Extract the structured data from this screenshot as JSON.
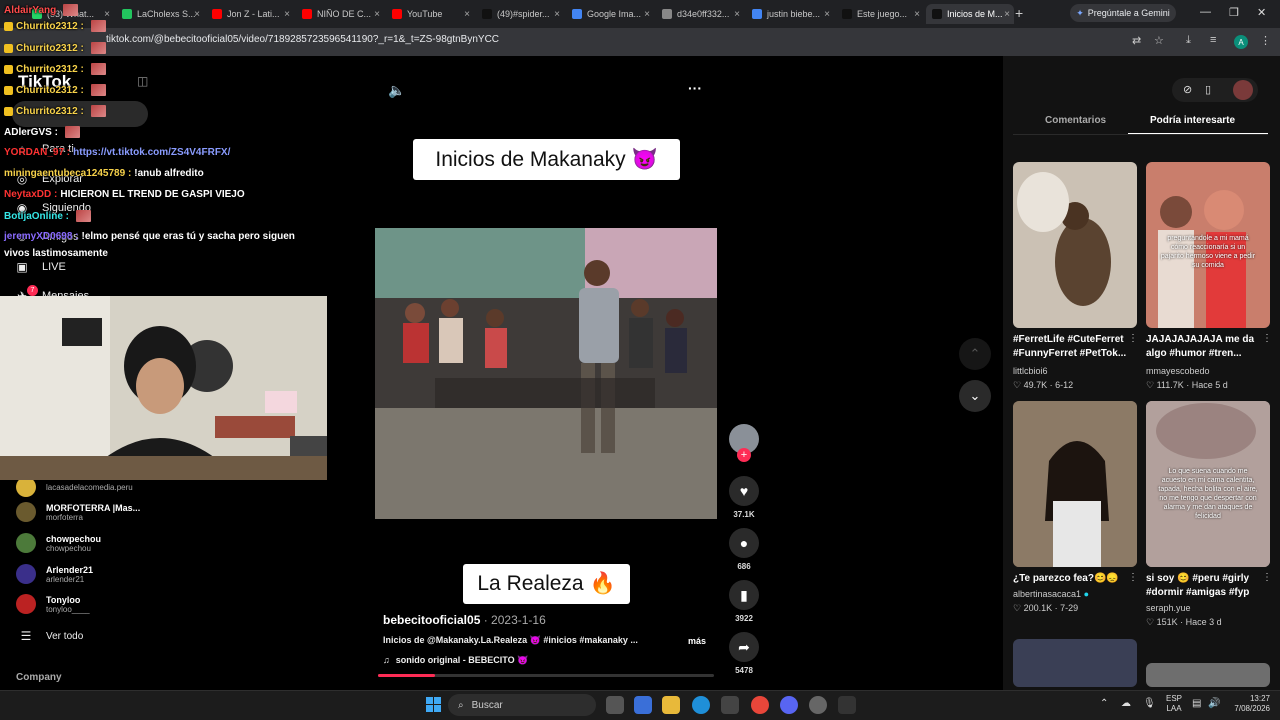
{
  "browser": {
    "tabs": [
      {
        "label": "(53) What..."
      },
      {
        "label": "LaCholexs S..."
      },
      {
        "label": "Jon Z - Lati..."
      },
      {
        "label": "NIÑO DE C..."
      },
      {
        "label": "YouTube"
      },
      {
        "label": "(49)#spider..."
      },
      {
        "label": "Google Ima..."
      },
      {
        "label": "d34e0ff332..."
      },
      {
        "label": "justin biebe..."
      },
      {
        "label": "Este juego..."
      },
      {
        "label": "Inicios de M..."
      }
    ],
    "new_tab_symbol": "+",
    "gemini_label": "Pregúntale a Gemini",
    "url": "tiktok.com/@bebecitooficial05/video/7189285723596541190?_r=1&_t=ZS-98gtnBynYCC",
    "profile_letter": "A"
  },
  "tiktok": {
    "logo": "TikTok",
    "nav": [
      {
        "label": "Para ti",
        "icon": "home-icon"
      },
      {
        "label": "Explorar",
        "icon": "compass-icon"
      },
      {
        "label": "Siguiendo",
        "icon": "following-icon"
      },
      {
        "label": "Amigos",
        "icon": "friends-icon"
      },
      {
        "label": "LIVE",
        "icon": "live-icon"
      },
      {
        "label": "Mensajes",
        "icon": "messages-icon",
        "badge": "7"
      }
    ],
    "following_accounts": [
      {
        "name": "",
        "handle": "lacasadelacomedia.peru"
      },
      {
        "name": "MORFOTERRA |Mas...",
        "handle": "morfoterra"
      },
      {
        "name": "chowpechou",
        "handle": "chowpechou"
      },
      {
        "name": "Arlender21",
        "handle": "arlender21"
      },
      {
        "name": "Tonyloo",
        "handle": "tonyloo____"
      }
    ],
    "see_all": "Ver todo",
    "company": "Company"
  },
  "chat": [
    {
      "user": "AldairYang",
      "text": "",
      "color": "#ff4b4b",
      "emote": true
    },
    {
      "user": "Churrito2312 :",
      "text": "",
      "color": "#f7d24a",
      "emote": true
    },
    {
      "user": "Churrito2312 :",
      "text": "",
      "color": "#f7d24a",
      "emote": true
    },
    {
      "user": "Churrito2312 :",
      "text": "",
      "color": "#f7d24a",
      "emote": true
    },
    {
      "user": "Churrito2312 :",
      "text": "",
      "color": "#f7d24a",
      "emote": true
    },
    {
      "user": "Churrito2312 :",
      "text": "",
      "color": "#f7d24a",
      "emote": true
    },
    {
      "user": "ADlerGVS :",
      "text": "",
      "color": "#ffffff",
      "emote": true
    },
    {
      "user": "YORDAN_97 :",
      "text": "https://vt.tiktok.com/ZS4V4FRFX/",
      "color": "#ff3333"
    },
    {
      "user": "miningaentubeca1245789 :",
      "text": "!anub alfredito",
      "color": "#f7d24a"
    },
    {
      "user": "NeytaxDD :",
      "text": "HICIERON EL TREND DE GASPI VIEJO",
      "color": "#ff3333"
    },
    {
      "user": "BotijaOnline :",
      "text": "",
      "color": "#35e8e8",
      "emote": true
    },
    {
      "user": "jeremyXD0698 :",
      "text": "!elmo pensé que eras tú y sacha pero siguen",
      "color": "#8a6bff"
    },
    {
      "user": "",
      "text": "vivos lastimosamente",
      "color": "#ffffff"
    }
  ],
  "video": {
    "title_overlay": "Inicios de Makanaky 😈",
    "caption_overlay": "La Realeza 🔥",
    "author": "bebecitooficial05",
    "date": "· 2023-1-16",
    "description": "Inicios de @Makanaky.La.Realeza 😈 #inicios #makanaky ...",
    "more": "más",
    "sound": "sonido original - BEBECITO 😈",
    "progress": 0.17,
    "likes": "37.1K",
    "comments": "686",
    "saves": "3922",
    "shares": "5478",
    "mute_icon": "volume-icon",
    "more_icon": "ellipsis-icon"
  },
  "right_panel": {
    "tabs": [
      "Comentarios",
      "Podría interesarte"
    ],
    "active_tab": "Podría interesarte",
    "cards": [
      {
        "title": "#FerretLife #CuteFerret #FunnyFerret #PetTok...",
        "user": "littlcbioi6",
        "likes": "49.7K",
        "date": "6-12",
        "color": "#c9bfb3"
      },
      {
        "title": "JAJAJAJAJAJA me da algo #humor #tren...",
        "user": "mmayescobedo",
        "likes": "111.7K",
        "date": "Hace 5 d",
        "color": "#c77a6a",
        "overlay": "preguntandole a mi mamá cómo reaccionaría si un pajarito hermoso viene a pedir su comida"
      },
      {
        "title": "¿Te parezco fea?😊😞",
        "user": "albertinasacaca1",
        "likes": "200.1K",
        "date": "7-29",
        "color": "#6a5340"
      },
      {
        "title": "si soy 😊 #peru #girly #dormir #amigas #fyp",
        "user": "seraph.yue",
        "likes": "151K",
        "date": "Hace 3 d",
        "color": "#b9a7a3",
        "overlay": "Lo que suena cuando me acuesto en mi cama calentita, tapada, hecha bolita con el aire, no me tengo que despertar con alarma y me dan ataques de felicidad"
      }
    ]
  },
  "taskbar": {
    "search": "Buscar",
    "lang_top": "ESP",
    "lang_bottom": "LAA",
    "time": "13:27",
    "date": "7/08/2026"
  }
}
